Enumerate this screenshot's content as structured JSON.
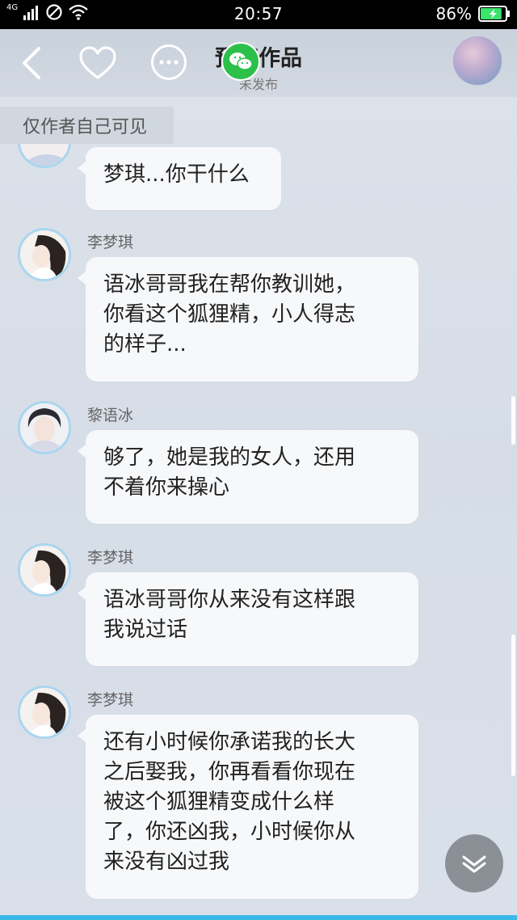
{
  "status_bar": {
    "signal_label": "4G",
    "time": "20:57",
    "battery_percent": "86%",
    "battery_level": 0.86
  },
  "header": {
    "title": "预览作品",
    "subtitle": "未发布",
    "icons": [
      "back-icon",
      "heart-icon",
      "more-icon",
      "wechat-icon",
      "avatar"
    ]
  },
  "visibility_notice": "仅作者自己可见",
  "messages": [
    {
      "sender": "",
      "text": [
        "梦琪...你干什么"
      ]
    },
    {
      "sender": "李梦琪",
      "text": [
        "语冰哥哥我在帮你教训她，",
        "你看这个狐狸精，小人得志",
        "的样子..."
      ]
    },
    {
      "sender": "黎语冰",
      "text": [
        "够了，她是我的女人，还用",
        "不着你来操心"
      ]
    },
    {
      "sender": "李梦琪",
      "text": [
        "语冰哥哥你从来没有这样跟",
        "我说过话"
      ]
    },
    {
      "sender": "李梦琪",
      "text": [
        "还有小时候你承诺我的长大",
        "之后娶我，你再看看你现在",
        "被这个狐狸精变成什么样",
        "了，你还凶我，小时候你从",
        "来没有凶过我"
      ]
    }
  ],
  "colors": {
    "accent": "#a9d6ef",
    "bubble": "#f7f8fa",
    "wechat": "#2cc04a",
    "battery": "#3be36a"
  }
}
